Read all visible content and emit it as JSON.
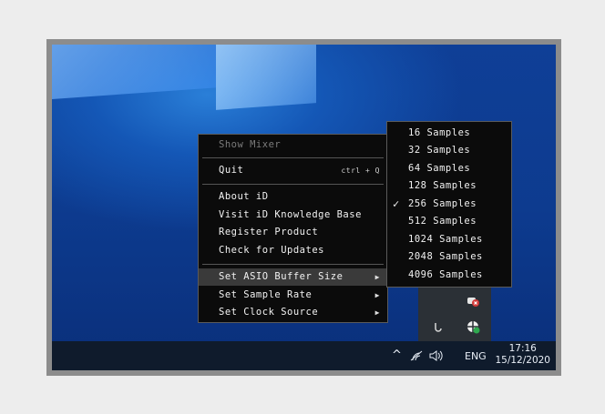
{
  "context_menu": {
    "show_mixer": "Show Mixer",
    "quit": "Quit",
    "quit_shortcut": "ctrl + Q",
    "about": "About iD",
    "knowledge_base": "Visit iD Knowledge Base",
    "register": "Register Product",
    "updates": "Check for Updates",
    "asio_buffer": "Set ASIO Buffer Size",
    "sample_rate": "Set Sample Rate",
    "clock_source": "Set Clock Source",
    "submenu_arrow": "▶"
  },
  "buffer_submenu": {
    "checkmark": "✓",
    "selected_index": 4,
    "items": [
      "16 Samples",
      "32 Samples",
      "64 Samples",
      "128 Samples",
      "256 Samples",
      "512 Samples",
      "1024 Samples",
      "2048 Samples",
      "4096 Samples"
    ]
  },
  "taskbar": {
    "chevron": "^",
    "wifi_icon": "wifi-icon",
    "volume_icon": "volume-icon",
    "language": "ENG",
    "time": "17:16",
    "date": "15/12/2020"
  },
  "colors": {
    "menu_bg": "#0b0b0b",
    "menu_highlight": "#3a3a3a",
    "taskbar_bg": "#0f1b2c",
    "desktop_blue": "#1457b6"
  }
}
